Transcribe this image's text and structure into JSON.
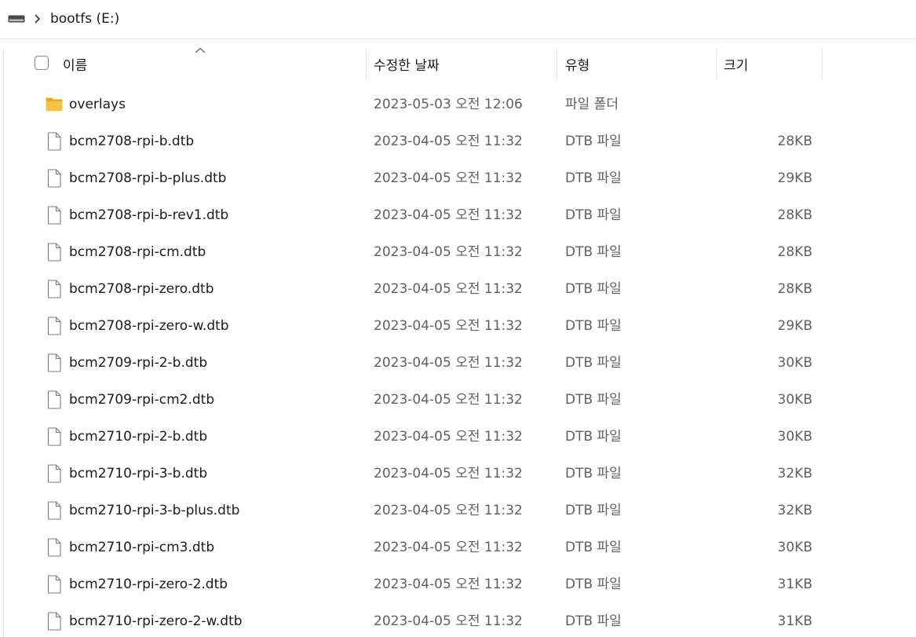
{
  "address": {
    "drive_icon": "drive-icon",
    "separator_icon": "chevron-right-icon",
    "breadcrumb": "bootfs (E:)"
  },
  "columns": {
    "name": "이름",
    "date": "수정한 날짜",
    "type": "유형",
    "size": "크기",
    "sort_icon": "sort-up-icon"
  },
  "files": [
    {
      "icon": "folder-icon",
      "name": "overlays",
      "date": "2023-05-03 오전 12:06",
      "type": "파일 폴더",
      "size": ""
    },
    {
      "icon": "file-icon",
      "name": "bcm2708-rpi-b.dtb",
      "date": "2023-04-05 오전 11:32",
      "type": "DTB 파일",
      "size": "28KB"
    },
    {
      "icon": "file-icon",
      "name": "bcm2708-rpi-b-plus.dtb",
      "date": "2023-04-05 오전 11:32",
      "type": "DTB 파일",
      "size": "29KB"
    },
    {
      "icon": "file-icon",
      "name": "bcm2708-rpi-b-rev1.dtb",
      "date": "2023-04-05 오전 11:32",
      "type": "DTB 파일",
      "size": "28KB"
    },
    {
      "icon": "file-icon",
      "name": "bcm2708-rpi-cm.dtb",
      "date": "2023-04-05 오전 11:32",
      "type": "DTB 파일",
      "size": "28KB"
    },
    {
      "icon": "file-icon",
      "name": "bcm2708-rpi-zero.dtb",
      "date": "2023-04-05 오전 11:32",
      "type": "DTB 파일",
      "size": "28KB"
    },
    {
      "icon": "file-icon",
      "name": "bcm2708-rpi-zero-w.dtb",
      "date": "2023-04-05 오전 11:32",
      "type": "DTB 파일",
      "size": "29KB"
    },
    {
      "icon": "file-icon",
      "name": "bcm2709-rpi-2-b.dtb",
      "date": "2023-04-05 오전 11:32",
      "type": "DTB 파일",
      "size": "30KB"
    },
    {
      "icon": "file-icon",
      "name": "bcm2709-rpi-cm2.dtb",
      "date": "2023-04-05 오전 11:32",
      "type": "DTB 파일",
      "size": "30KB"
    },
    {
      "icon": "file-icon",
      "name": "bcm2710-rpi-2-b.dtb",
      "date": "2023-04-05 오전 11:32",
      "type": "DTB 파일",
      "size": "30KB"
    },
    {
      "icon": "file-icon",
      "name": "bcm2710-rpi-3-b.dtb",
      "date": "2023-04-05 오전 11:32",
      "type": "DTB 파일",
      "size": "32KB"
    },
    {
      "icon": "file-icon",
      "name": "bcm2710-rpi-3-b-plus.dtb",
      "date": "2023-04-05 오전 11:32",
      "type": "DTB 파일",
      "size": "32KB"
    },
    {
      "icon": "file-icon",
      "name": "bcm2710-rpi-cm3.dtb",
      "date": "2023-04-05 오전 11:32",
      "type": "DTB 파일",
      "size": "30KB"
    },
    {
      "icon": "file-icon",
      "name": "bcm2710-rpi-zero-2.dtb",
      "date": "2023-04-05 오전 11:32",
      "type": "DTB 파일",
      "size": "31KB"
    },
    {
      "icon": "file-icon",
      "name": "bcm2710-rpi-zero-2-w.dtb",
      "date": "2023-04-05 오전 11:32",
      "type": "DTB 파일",
      "size": "31KB"
    }
  ],
  "colors": {
    "folder": "#f5c242",
    "folder_dark": "#e6a817",
    "file_outline": "#7a7a7a",
    "secondary_text": "#5f5f5f"
  }
}
